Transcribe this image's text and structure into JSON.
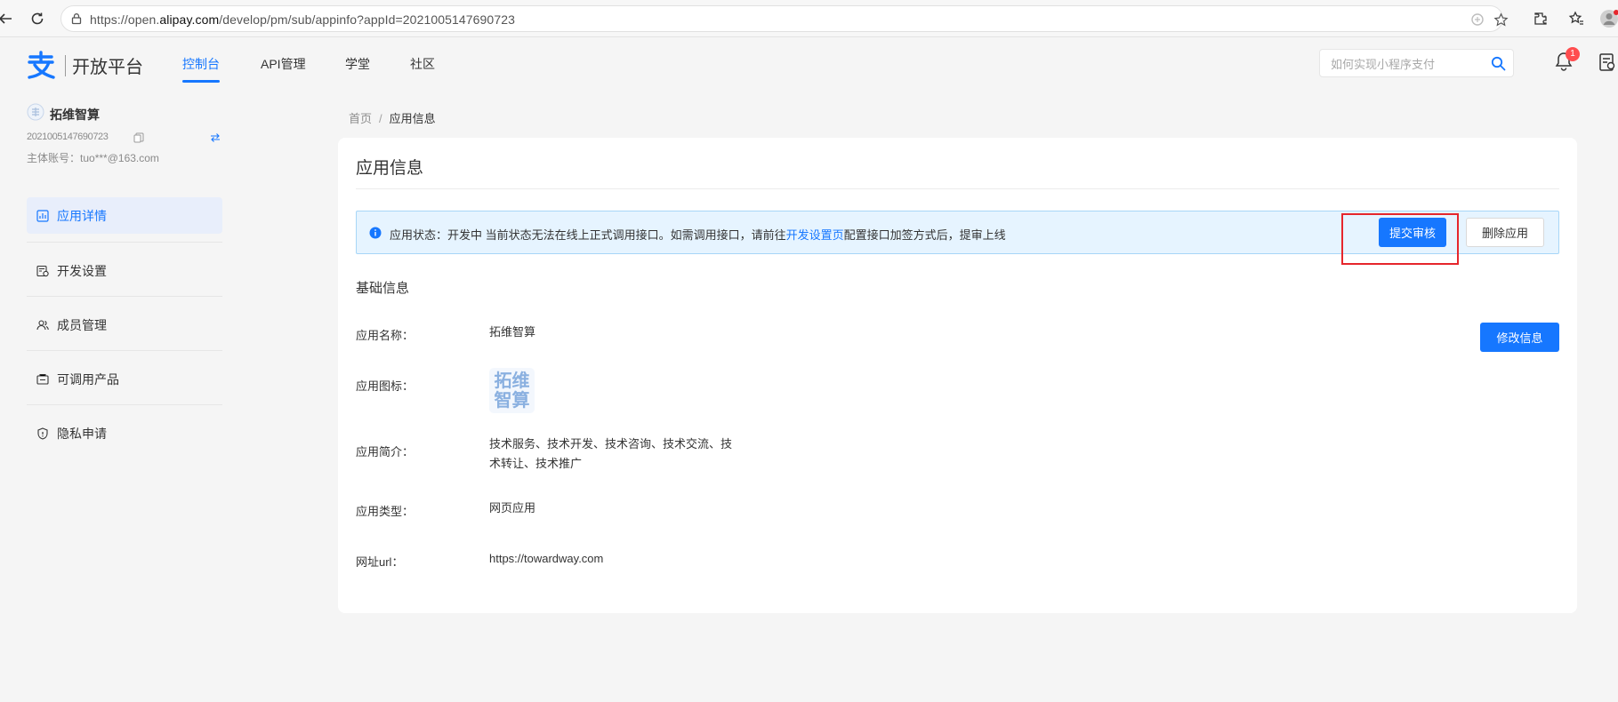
{
  "browser": {
    "url_prefix": "https://open.",
    "url_domain": "alipay.com",
    "url_path": "/develop/pm/sub/appinfo?appId=2021005147690723"
  },
  "nav": {
    "brand": "开放平台",
    "items": [
      "控制台",
      "API管理",
      "学堂",
      "社区"
    ],
    "search_placeholder": "如何实现小程序支付",
    "notification_count": "1"
  },
  "sidebar": {
    "app_name": "拓维智算",
    "app_id": "2021005147690723",
    "account_label": "主体账号：",
    "account_value": "tuo***@163.com",
    "items": [
      {
        "label": "应用详情",
        "icon": "chart-icon"
      },
      {
        "label": "开发设置",
        "icon": "settings-doc-icon"
      },
      {
        "label": "成员管理",
        "icon": "members-icon"
      },
      {
        "label": "可调用产品",
        "icon": "product-icon"
      },
      {
        "label": "隐私申请",
        "icon": "shield-icon"
      }
    ]
  },
  "breadcrumb": {
    "home": "首页",
    "separator": "/",
    "current": "应用信息"
  },
  "card": {
    "title": "应用信息",
    "alert": {
      "prefix": "应用状态：开发中 当前状态无法在线上正式调用接口。如需调用接口，请前往",
      "link": "开发设置页",
      "suffix": "配置接口加签方式后，提审上线"
    },
    "submit_label": "提交审核",
    "delete_label": "删除应用",
    "section_title": "基础信息",
    "edit_label": "修改信息",
    "fields": {
      "name_label": "应用名称：",
      "name_value": "拓维智算",
      "icon_label": "应用图标：",
      "icon_text_line1": "拓维",
      "icon_text_line2": "智算",
      "desc_label": "应用简介：",
      "desc_line1": "技术服务、技术开发、技术咨询、技术交流、技",
      "desc_line2": "术转让、技术推广",
      "type_label": "应用类型：",
      "type_value": "网页应用",
      "url_label": "网址url：",
      "url_value": "https://towardway.com"
    }
  },
  "colors": {
    "accent": "#1677ff",
    "highlight": "#e6262c",
    "alert_bg": "#e6f4ff"
  }
}
